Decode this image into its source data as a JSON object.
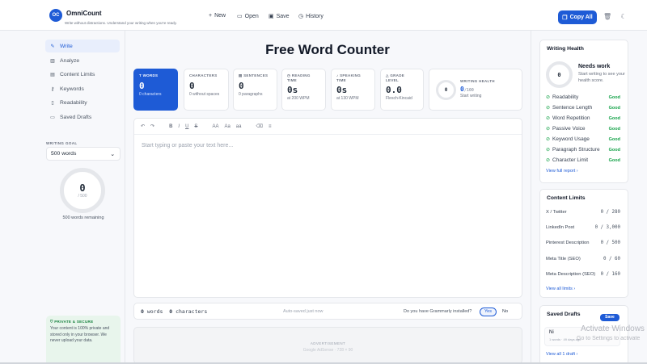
{
  "app": {
    "logo": "OC",
    "name": "OmniCount",
    "tagline": "Write without distractions. Understand your writing when you're ready."
  },
  "toolbar_top": {
    "new": "New",
    "open": "Open",
    "save": "Save",
    "history": "History",
    "copy_all": "Copy All"
  },
  "sidebar": {
    "items": [
      {
        "label": "Write",
        "icon": "pen-icon"
      },
      {
        "label": "Analyze",
        "icon": "bar-chart-icon"
      },
      {
        "label": "Content Limits",
        "icon": "document-icon"
      },
      {
        "label": "Keywords",
        "icon": "key-icon"
      },
      {
        "label": "Readability",
        "icon": "book-icon"
      },
      {
        "label": "Saved Drafts",
        "icon": "folder-icon"
      }
    ],
    "goal_label": "WRITING GOAL",
    "goal_value": "500 words",
    "goal_count": "0",
    "goal_total": "/ 500",
    "goal_remaining": "500 words remaining",
    "privacy_title": "PRIVATE & SECURE",
    "privacy_text": "Your content is 100% private and stored only in your browser. We never upload your data."
  },
  "main": {
    "title": "Free Word Counter",
    "stats": {
      "words": {
        "label": "WORDS",
        "value": "0",
        "sub": "0 characters"
      },
      "characters": {
        "label": "CHARACTERS",
        "value": "0",
        "sub": "0 without spaces"
      },
      "sentences": {
        "label": "SENTENCES",
        "value": "0",
        "sub": "0 paragraphs"
      },
      "reading": {
        "label": "READING TIME",
        "value": "0s",
        "sub": "at 200 WPM"
      },
      "speaking": {
        "label": "SPEAKING TIME",
        "value": "0s",
        "sub": "at 130 WPM"
      },
      "grade": {
        "label": "GRADE LEVEL",
        "value": "0.0",
        "sub": "Flesch-Kincaid"
      },
      "health": {
        "label": "WRITING HEALTH",
        "value": "0",
        "total": "/100",
        "sub": "Start writing",
        "ring": "0"
      }
    },
    "editor_tools": [
      "↶",
      "↷",
      "B",
      "I",
      "U",
      "S",
      "AA",
      "Aa",
      "aa",
      "⌫",
      "≡"
    ],
    "placeholder": "Start typing or paste your text here...",
    "bottom": {
      "words": "0",
      "words_label": "words",
      "chars": "0",
      "chars_label": "characters",
      "saved": "Auto-saved just now",
      "grammarly": "Do you have Grammarly installed?",
      "yes": "Yes",
      "no": "No"
    },
    "ad": {
      "label": "ADVERTISEMENT",
      "size": "Google AdSense · 728 × 90"
    }
  },
  "right": {
    "health": {
      "title": "Writing Health",
      "score": "0",
      "status": "Needs work",
      "desc": "Start writing to see your health score.",
      "rows": [
        {
          "label": "Readability",
          "status": "Good"
        },
        {
          "label": "Sentence Length",
          "status": "Good"
        },
        {
          "label": "Word Repetition",
          "status": "Good"
        },
        {
          "label": "Passive Voice",
          "status": "Good"
        },
        {
          "label": "Keyword Usage",
          "status": "Good"
        },
        {
          "label": "Paragraph Structure",
          "status": "Good"
        },
        {
          "label": "Character Limit",
          "status": "Good"
        }
      ],
      "link": "View full report ›"
    },
    "limits": {
      "title": "Content Limits",
      "rows": [
        {
          "label": "X / Twitter",
          "value": "0 / 280"
        },
        {
          "label": "LinkedIn Post",
          "value": "0 / 3,000"
        },
        {
          "label": "Pinterest Description",
          "value": "0 / 500"
        },
        {
          "label": "Meta Title (SEO)",
          "value": "0 / 60"
        },
        {
          "label": "Meta Description (SEO)",
          "value": "0 / 160"
        }
      ],
      "link": "View all limits ›"
    },
    "drafts": {
      "title": "Saved Drafts",
      "save": "Save",
      "item_title": "Ni",
      "item_meta": "1 words · 49 days ago",
      "link": "View all 1 draft ›"
    }
  },
  "os": {
    "watermark_title": "Activate Windows",
    "watermark_sub": "Go to Settings to activate"
  }
}
